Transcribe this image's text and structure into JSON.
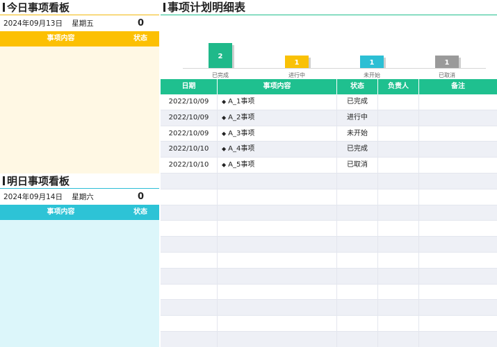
{
  "today": {
    "title": "今日事项看板",
    "date": "2024年09月13日",
    "weekday": "星期五",
    "count": "0",
    "col_content": "事项内容",
    "col_status": "状态"
  },
  "tomorrow": {
    "title": "明日事项看板",
    "date": "2024年09月14日",
    "weekday": "星期六",
    "count": "0",
    "col_content": "事项内容",
    "col_status": "状态"
  },
  "detail": {
    "title": "事项计划明细表",
    "columns": [
      "日期",
      "事项内容",
      "状态",
      "负责人",
      "备注"
    ],
    "rows": [
      {
        "date": "2022/10/09",
        "content": "A_1事项",
        "status": "已完成",
        "owner": "",
        "note": ""
      },
      {
        "date": "2022/10/09",
        "content": "A_2事项",
        "status": "进行中",
        "owner": "",
        "note": ""
      },
      {
        "date": "2022/10/09",
        "content": "A_3事项",
        "status": "未开始",
        "owner": "",
        "note": ""
      },
      {
        "date": "2022/10/10",
        "content": "A_4事项",
        "status": "已完成",
        "owner": "",
        "note": ""
      },
      {
        "date": "2022/10/10",
        "content": "A_5事项",
        "status": "已取消",
        "owner": "",
        "note": ""
      }
    ],
    "empty_rows": 11
  },
  "chart_data": {
    "type": "bar",
    "categories": [
      "已完成",
      "进行中",
      "未开始",
      "已取消"
    ],
    "values": [
      2,
      1,
      1,
      1
    ],
    "colors": [
      "#1fb98a",
      "#f9c106",
      "#2cbfd4",
      "#9a9a9a"
    ],
    "ylim": [
      0,
      2
    ]
  },
  "colors": {
    "today_accent": "#fcc003",
    "tomorrow_accent": "#2dc3d6",
    "detail_accent": "#1fc08f"
  }
}
